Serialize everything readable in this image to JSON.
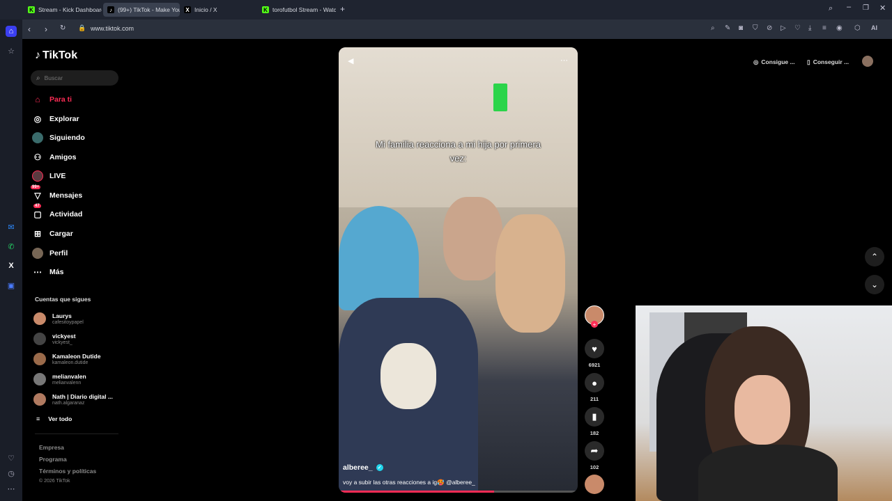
{
  "browser": {
    "tabs": [
      {
        "title": "Stream - Kick Dashboard",
        "favicon": "K",
        "favicon_color": "#53fc18"
      },
      {
        "title": "(99+) TikTok - Make Your Day",
        "favicon": "♪",
        "favicon_color": "#000000"
      },
      {
        "title": "Inicio / X",
        "favicon": "X",
        "favicon_color": "#000000"
      },
      {
        "title": "torofutbol Stream - Watch",
        "favicon": "K",
        "favicon_color": "#53fc18"
      }
    ],
    "url": "www.tiktok.com",
    "ai_label": "AI"
  },
  "tiktok": {
    "logo": "TikTok",
    "search_placeholder": "Buscar",
    "menu": [
      {
        "label": "Para ti",
        "icon": "home-icon",
        "active": true
      },
      {
        "label": "Explorar",
        "icon": "compass-icon"
      },
      {
        "label": "Siguiendo",
        "icon": "following-icon"
      },
      {
        "label": "Amigos",
        "icon": "friends-icon"
      },
      {
        "label": "LIVE",
        "icon": "live-icon"
      },
      {
        "label": "Mensajes",
        "icon": "messages-icon",
        "badge": "99+"
      },
      {
        "label": "Actividad",
        "icon": "activity-icon",
        "badge": "47"
      },
      {
        "label": "Cargar",
        "icon": "upload-icon"
      },
      {
        "label": "Perfil",
        "icon": "profile-icon"
      },
      {
        "label": "Más",
        "icon": "more-icon"
      }
    ],
    "following_title": "Cuentas que sigues",
    "following": [
      {
        "name": "Laurys",
        "handle": "cafesitoypapel"
      },
      {
        "name": "vickyest",
        "handle": "vickyest_"
      },
      {
        "name": "Kamaleon Dutide",
        "handle": "kamaleon.dutide"
      },
      {
        "name": "melianvalen",
        "handle": "melianvalenn"
      },
      {
        "name": "Nath | Diario digital ...",
        "handle": "nath.algaranaz"
      }
    ],
    "see_all": "Ver todo",
    "footer": [
      "Empresa",
      "Programa",
      "Términos y políticas",
      "© 2026 TikTok"
    ],
    "top_right": {
      "coins": "Consigue ...",
      "app": "Conseguir ..."
    },
    "video": {
      "caption_overlay": "Mi familia reacciona a mi hija por primera vez:",
      "author": "alberee_",
      "description": "voy a subir las otras reacciones a ig🥵 @alberee_",
      "progress": 0.65
    },
    "actions": {
      "likes": "6921",
      "comments": "211",
      "saves": "182",
      "shares": "102"
    }
  }
}
